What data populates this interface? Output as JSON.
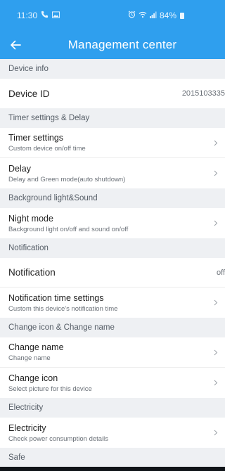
{
  "status_bar": {
    "time": "11:30",
    "battery": "84%",
    "icons": [
      "phone-icon",
      "image-icon",
      "alarm-icon",
      "wifi-icon",
      "signal-icon",
      "battery-icon"
    ]
  },
  "header": {
    "title": "Management center",
    "color": "#2f9fee"
  },
  "sections": {
    "device_info": "Device info",
    "timer": "Timer settings & Delay",
    "background": "Background light&Sound",
    "notification": "Notification",
    "change": "Change icon & Change name",
    "electricity": "Electricity",
    "safe": "Safe"
  },
  "rows": {
    "device_id": {
      "title": "Device ID",
      "value": "2015103335"
    },
    "timer_settings": {
      "title": "Timer settings",
      "subtitle": "Custom device on/off time"
    },
    "delay": {
      "title": "Delay",
      "subtitle": "Delay and Green mode(auto shutdown)"
    },
    "night_mode": {
      "title": "Night mode",
      "subtitle": "Background light on/off and sound on/off"
    },
    "notification": {
      "title": "Notification",
      "value": "off"
    },
    "notification_time": {
      "title": "Notification time settings",
      "subtitle": "Custom this device's notification time"
    },
    "change_name": {
      "title": "Change name",
      "subtitle": "Change name"
    },
    "change_icon": {
      "title": "Change icon",
      "subtitle": "Select picture for this device"
    },
    "electricity": {
      "title": "Electricity",
      "subtitle": "Check power consumption details"
    }
  }
}
